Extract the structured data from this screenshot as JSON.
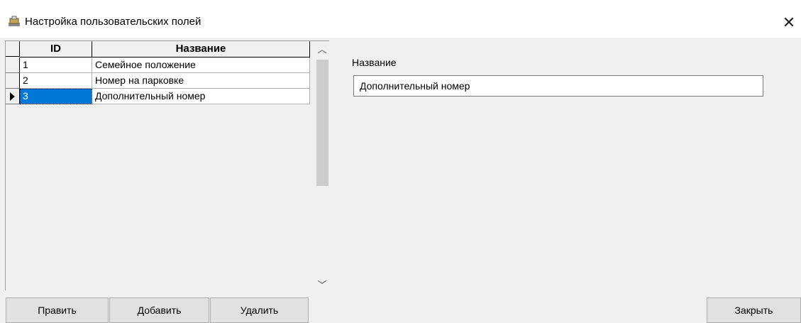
{
  "window": {
    "title": "Настройка пользовательских полей",
    "icon": "table-settings-icon",
    "close_glyph": "✕"
  },
  "grid": {
    "columns": [
      "ID",
      "Название"
    ],
    "rows": [
      {
        "id": "1",
        "name": "Семейное положение"
      },
      {
        "id": "2",
        "name": "Номер на парковке"
      },
      {
        "id": "3",
        "name": "Дополнительный номер"
      }
    ],
    "selected_row": 2
  },
  "details": {
    "label": "Название",
    "value": "Дополнительный номер"
  },
  "buttons": {
    "edit": "Править",
    "add": "Добавить",
    "delete": "Удалить",
    "close": "Закрыть"
  },
  "colors": {
    "selection": "#0078d7",
    "background": "#f0f0f0"
  }
}
